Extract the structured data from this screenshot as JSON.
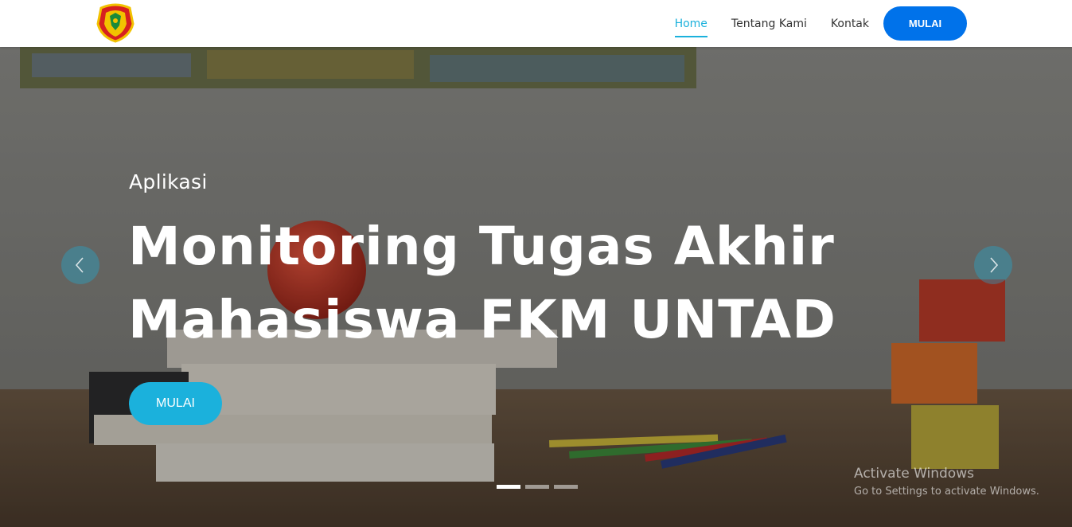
{
  "header": {
    "logo_icon": "untad-crest-icon",
    "nav": [
      {
        "label": "Home",
        "active": true
      },
      {
        "label": "Tentang Kami",
        "active": false
      },
      {
        "label": "Kontak",
        "active": false
      }
    ],
    "cta_label": "MULAI"
  },
  "hero": {
    "subtitle": "Aplikasi",
    "title_line1": "Monitoring Tugas Akhir",
    "title_line2": "Mahasiswa FKM UNTAD",
    "button_label": "MULAI",
    "prev_icon": "chevron-left-icon",
    "next_icon": "chevron-right-icon",
    "slides_total": 3,
    "active_slide": 1
  },
  "watermark": {
    "title": "Activate Windows",
    "subtitle": "Go to Settings to activate Windows."
  },
  "colors": {
    "accent": "#1bb1dc",
    "primary_button": "#0072ea",
    "header_bg": "#ffffff"
  }
}
